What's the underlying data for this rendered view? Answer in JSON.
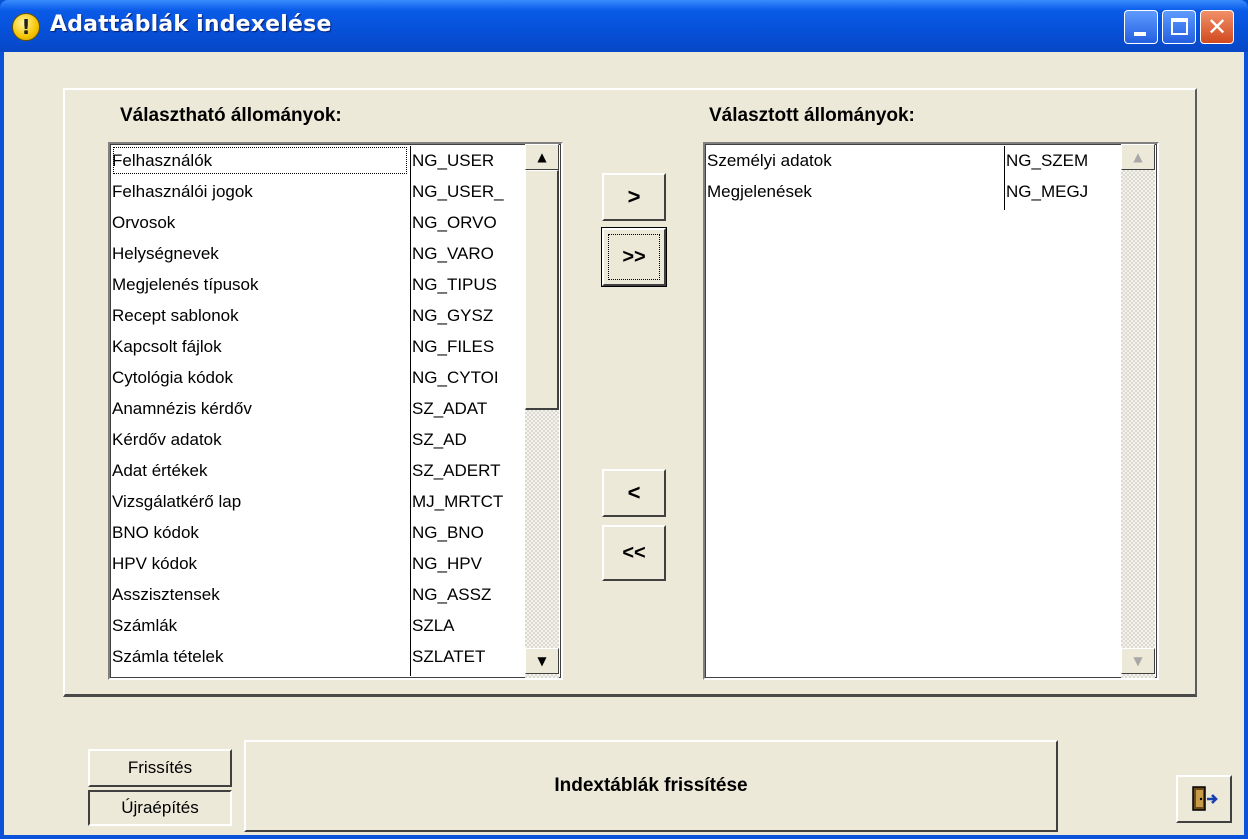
{
  "window": {
    "title": "Adattáblák indexelése",
    "accent": "#0a53d8",
    "close_color": "#d2491f"
  },
  "available": {
    "heading": "Választható állományok:",
    "items": [
      {
        "name": "Felhasználók",
        "table": "NG_USER"
      },
      {
        "name": "Felhasználói jogok",
        "table": "NG_USER_"
      },
      {
        "name": "Orvosok",
        "table": "NG_ORVO"
      },
      {
        "name": "Helységnevek",
        "table": "NG_VARO"
      },
      {
        "name": "Megjelenés típusok",
        "table": "NG_TIPUS"
      },
      {
        "name": "Recept sablonok",
        "table": "NG_GYSZ"
      },
      {
        "name": "Kapcsolt fájlok",
        "table": "NG_FILES"
      },
      {
        "name": "Cytológia kódok",
        "table": "NG_CYTOI"
      },
      {
        "name": "Anamnézis kérdőv",
        "table": "SZ_ADAT"
      },
      {
        "name": "Kérdőv adatok",
        "table": "SZ_AD"
      },
      {
        "name": "Adat értékek",
        "table": "SZ_ADERT"
      },
      {
        "name": "Vizsgálatkérő lap",
        "table": "MJ_MRTCT"
      },
      {
        "name": "BNO kódok",
        "table": "NG_BNO"
      },
      {
        "name": "HPV kódok",
        "table": "NG_HPV"
      },
      {
        "name": "Asszisztensek",
        "table": "NG_ASSZ"
      },
      {
        "name": "Számlák",
        "table": "SZLA"
      },
      {
        "name": "Számla tételek",
        "table": "SZLATET"
      }
    ]
  },
  "selected": {
    "heading": "Választott állományok:",
    "items": [
      {
        "name": "Személyi adatok",
        "table": "NG_SZEM"
      },
      {
        "name": "Megjelenések",
        "table": "NG_MEGJ"
      }
    ]
  },
  "buttons": {
    "add_one": ">",
    "add_all": ">>",
    "remove_one": "<",
    "remove_all": "<<",
    "refresh_mode": "Frissítés",
    "rebuild_mode": "Újraépítés",
    "run": "Indextáblák frissítése"
  },
  "icons": {
    "title": "warning-icon",
    "exit": "exit-door-icon",
    "scroll_up": "▲",
    "scroll_down": "▼"
  }
}
